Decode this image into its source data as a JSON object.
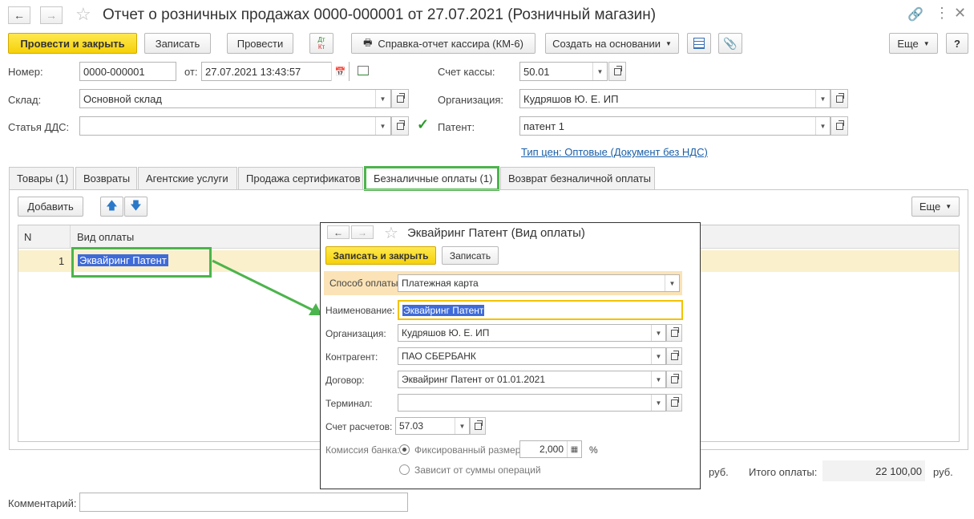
{
  "window": {
    "title": "Отчет о розничных продажах 0000-000001 от 27.07.2021 (Розничный магазин)"
  },
  "toolbar": {
    "post_close": "Провести и закрыть",
    "save": "Записать",
    "post": "Провести",
    "dtkt_top": "Дт",
    "dtkt_bottom": "Кт",
    "cashier_report": "Справка-отчет кассира (КМ-6)",
    "create_based": "Создать на основании",
    "more": "Еще",
    "help": "?"
  },
  "form": {
    "number_label": "Номер:",
    "number_value": "0000-000001",
    "date_label": "от:",
    "date_value": "27.07.2021 13:43:57",
    "cash_account_label": "Счет кассы:",
    "cash_account_value": "50.01",
    "warehouse_label": "Склад:",
    "warehouse_value": "Основной склад",
    "organization_label": "Организация:",
    "organization_value": "Кудряшов Ю. Е. ИП",
    "dds_label": "Статья ДДС:",
    "dds_value": "",
    "patent_label": "Патент:",
    "patent_value": "патент 1",
    "price_type_link": "Тип цен: Оптовые (Документ без НДС)",
    "comment_label": "Комментарий:",
    "comment_value": ""
  },
  "tabs": [
    {
      "label": "Товары (1)"
    },
    {
      "label": "Возвраты"
    },
    {
      "label": "Агентские услуги"
    },
    {
      "label": "Продажа сертификатов"
    },
    {
      "label": "Безналичные оплаты (1)"
    },
    {
      "label": "Возврат безналичной оплаты"
    }
  ],
  "table_toolbar": {
    "add": "Добавить",
    "more": "Еще"
  },
  "table": {
    "columns": [
      "N",
      "Вид оплаты"
    ],
    "rows": [
      {
        "n": "1",
        "payment_type": "Эквайринг Патент"
      }
    ]
  },
  "totals": {
    "currency1": "руб.",
    "total_label": "Итого оплаты:",
    "total_value": "22 100,00",
    "currency2": "руб."
  },
  "dialog": {
    "title": "Эквайринг Патент (Вид оплаты)",
    "save_close": "Записать и закрыть",
    "save": "Записать",
    "payment_method_label": "Способ оплаты:",
    "payment_method_value": "Платежная карта",
    "name_label": "Наименование:",
    "name_value": "Эквайринг Патент",
    "organization_label": "Организация:",
    "organization_value": "Кудряшов Ю. Е. ИП",
    "counterparty_label": "Контрагент:",
    "counterparty_value": "ПАО СБЕРБАНК",
    "contract_label": "Договор:",
    "contract_value": "Эквайринг Патент от 01.01.2021",
    "terminal_label": "Терминал:",
    "terminal_value": "",
    "account_label": "Счет расчетов:",
    "account_value": "57.03",
    "commission_label": "Комиссия банка:",
    "fixed_label": "Фиксированный размер",
    "fixed_value": "2,000",
    "percent_sign": "%",
    "depends_label": "Зависит от суммы операций"
  },
  "colors": {
    "accent_yellow": "#f5d10a",
    "highlight_green": "#4cb44c",
    "link_blue": "#1a5fa8",
    "selection_blue": "#3f6bd8",
    "row_highlight": "#fbf0cc"
  }
}
